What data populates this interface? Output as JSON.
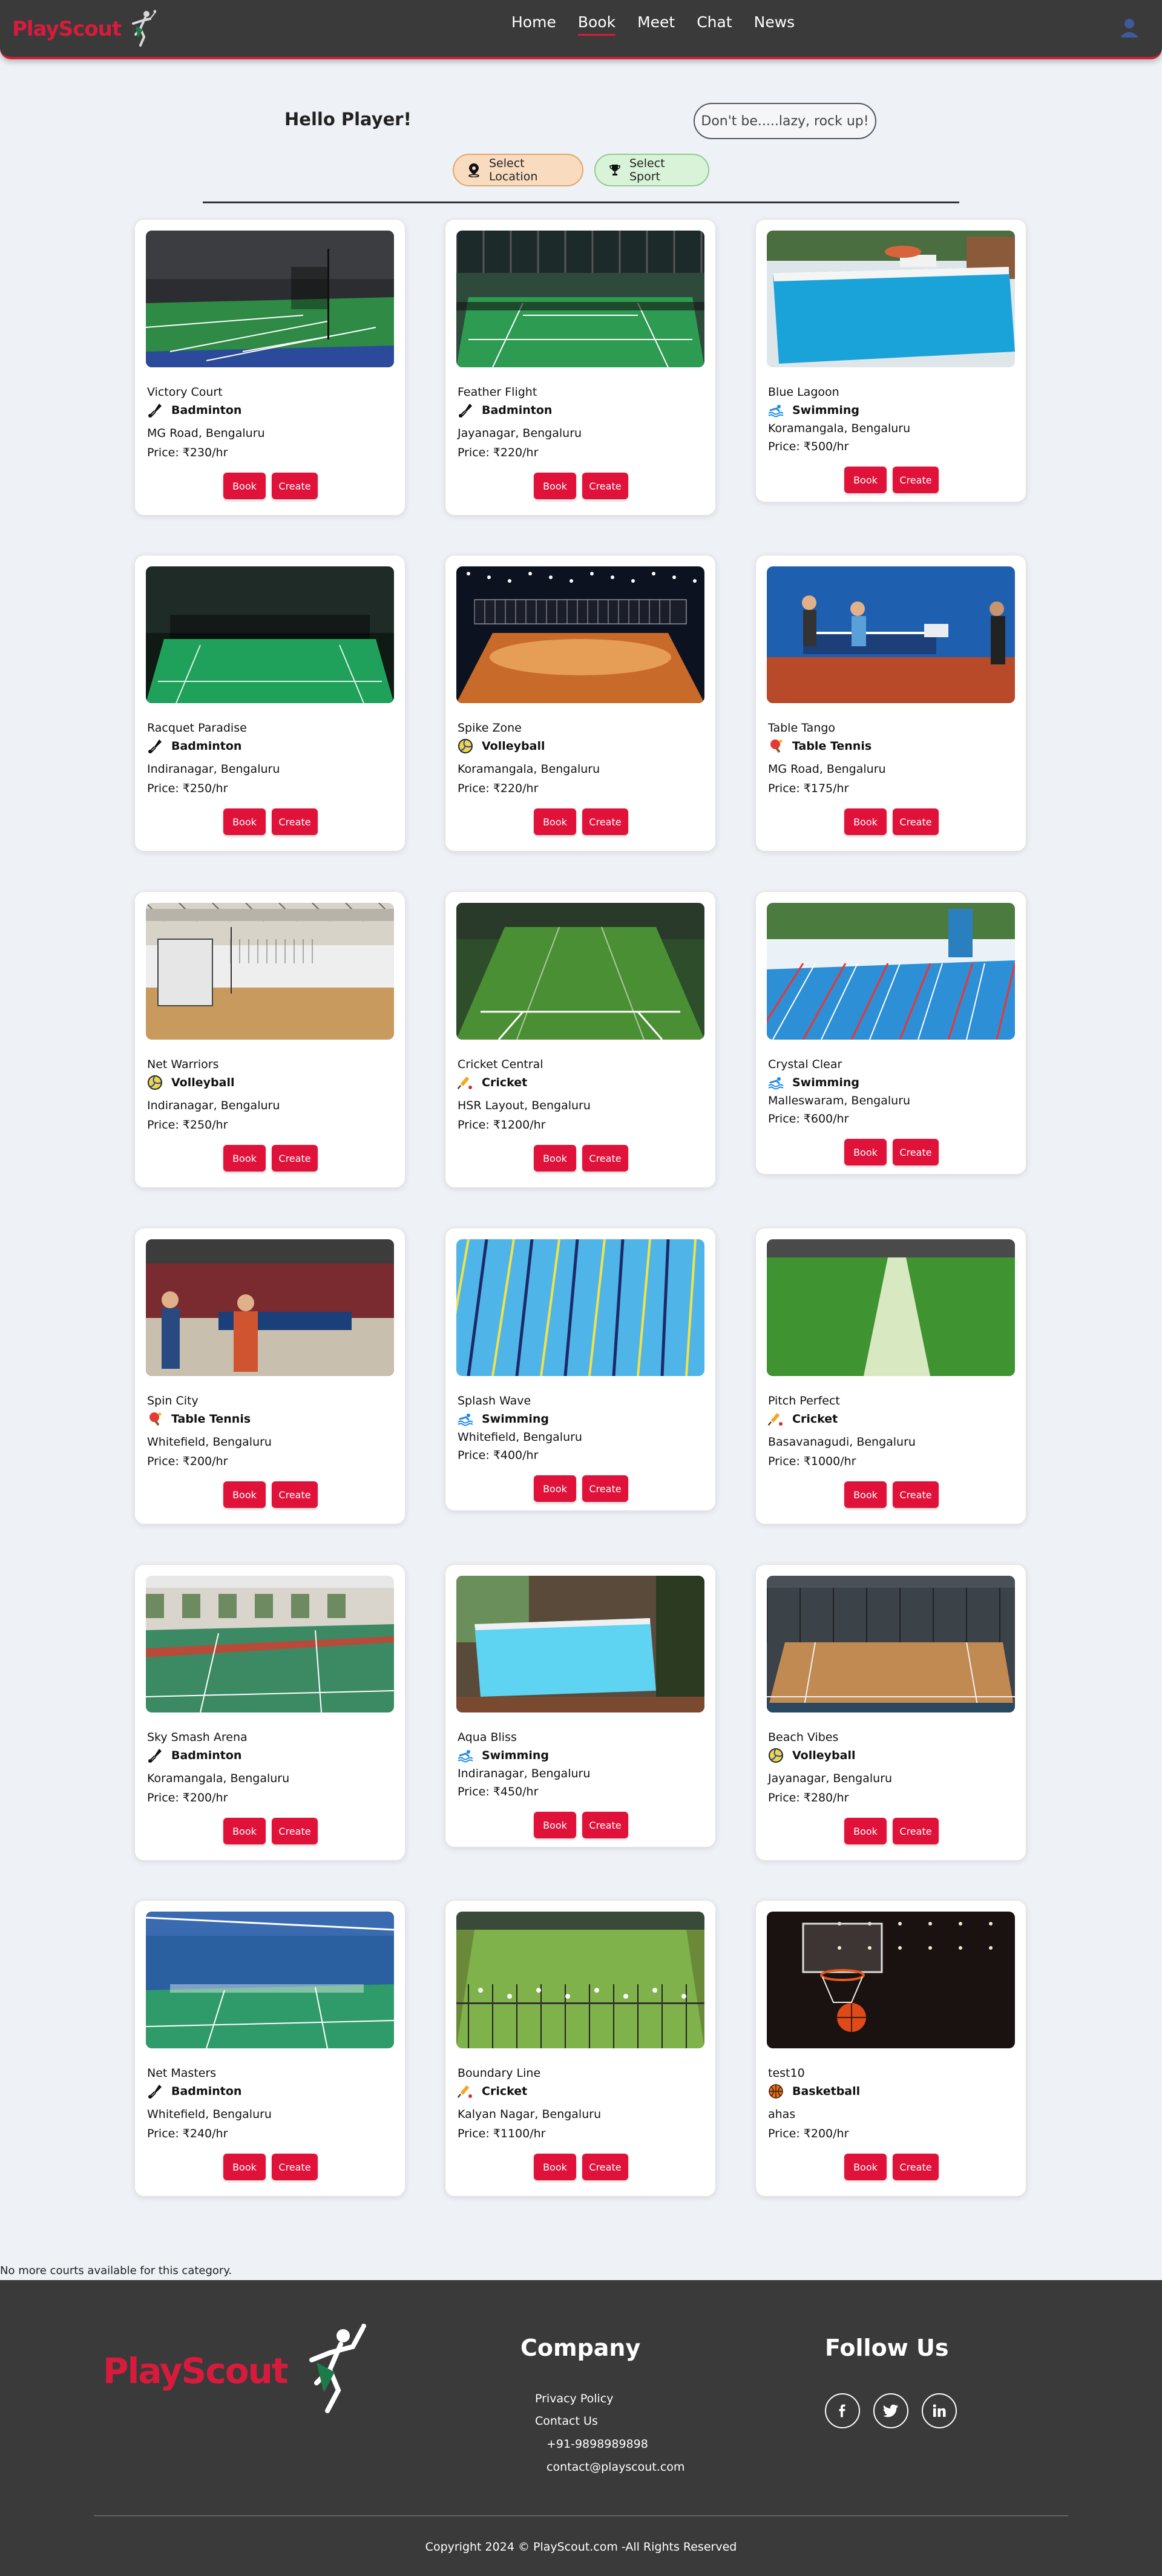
{
  "nav": {
    "brand_text": "PlayScout",
    "links": [
      {
        "label": "Home",
        "active": false
      },
      {
        "label": "Book",
        "active": true
      },
      {
        "label": "Meet",
        "active": false
      },
      {
        "label": "Chat",
        "active": false
      },
      {
        "label": "News",
        "active": false
      }
    ]
  },
  "greeting": "Hello Player!",
  "tagline": "Don't be.....lazy, rock up!",
  "filters": {
    "location_label": "Select Location",
    "sport_label": "Select Sport"
  },
  "buttons": {
    "book_label": "Book",
    "create_label": "Create"
  },
  "courts": [
    {
      "name": "Victory Court",
      "sport": "Badminton",
      "location": "MG Road, Bengaluru",
      "price": "Price: ₹230/hr",
      "icon": "shuttlecock-icon",
      "scene": "badminton-dark"
    },
    {
      "name": "Feather Flight",
      "sport": "Badminton",
      "location": "Jayanagar, Bengaluru",
      "price": "Price: ₹220/hr",
      "icon": "shuttlecock-icon",
      "scene": "badminton-hall"
    },
    {
      "name": "Blue Lagoon",
      "sport": "Swimming",
      "location": "Koramangala, Bengaluru",
      "price": "Price: ₹500/hr",
      "icon": "swimmer-icon",
      "scene": "pool-outdoor"
    },
    {
      "name": "Racquet Paradise",
      "sport": "Badminton",
      "location": "Indiranagar, Bengaluru",
      "price": "Price: ₹250/hr",
      "icon": "shuttlecock-icon",
      "scene": "badminton-green"
    },
    {
      "name": "Spike Zone",
      "sport": "Volleyball",
      "location": "Koramangala, Bengaluru",
      "price": "Price: ₹220/hr",
      "icon": "volleyball-icon",
      "scene": "volleyball-arena"
    },
    {
      "name": "Table Tango",
      "sport": "Table Tennis",
      "location": "MG Road, Bengaluru",
      "price": "Price: ₹175/hr",
      "icon": "paddle-icon",
      "scene": "tabletennis-blue"
    },
    {
      "name": "Net Warriors",
      "sport": "Volleyball",
      "location": "Indiranagar, Bengaluru",
      "price": "Price: ₹250/hr",
      "icon": "volleyball-icon",
      "scene": "indoor-wood"
    },
    {
      "name": "Cricket Central",
      "sport": "Cricket",
      "location": "HSR Layout, Bengaluru",
      "price": "Price: ₹1200/hr",
      "icon": "cricket-bat-icon",
      "scene": "cricket-turf"
    },
    {
      "name": "Crystal Clear",
      "sport": "Swimming",
      "location": "Malleswaram, Bengaluru",
      "price": "Price: ₹600/hr",
      "icon": "swimmer-icon",
      "scene": "pool-lanes-outdoor"
    },
    {
      "name": "Spin City",
      "sport": "Table Tennis",
      "location": "Whitefield, Bengaluru",
      "price": "Price: ₹200/hr",
      "icon": "paddle-icon",
      "scene": "tabletennis-hall"
    },
    {
      "name": "Splash Wave",
      "sport": "Swimming",
      "location": "Whitefield, Bengaluru",
      "price": "Price: ₹400/hr",
      "icon": "swimmer-icon",
      "scene": "pool-lanes"
    },
    {
      "name": "Pitch Perfect",
      "sport": "Cricket",
      "location": "Basavanagudi, Bengaluru",
      "price": "Price: ₹1000/hr",
      "icon": "cricket-bat-icon",
      "scene": "cricket-pitch"
    },
    {
      "name": "Sky Smash Arena",
      "sport": "Badminton",
      "location": "Koramangala, Bengaluru",
      "price": "Price: ₹200/hr",
      "icon": "shuttlecock-icon",
      "scene": "badminton-red"
    },
    {
      "name": "Aqua Bliss",
      "sport": "Swimming",
      "location": "Indiranagar, Bengaluru",
      "price": "Price: ₹450/hr",
      "icon": "swimmer-icon",
      "scene": "pool-rooftop"
    },
    {
      "name": "Beach Vibes",
      "sport": "Volleyball",
      "location": "Jayanagar, Bengaluru",
      "price": "Price: ₹280/hr",
      "icon": "volleyball-icon",
      "scene": "court-wood"
    },
    {
      "name": "Net Masters",
      "sport": "Badminton",
      "location": "Whitefield, Bengaluru",
      "price": "Price: ₹240/hr",
      "icon": "shuttlecock-icon",
      "scene": "badminton-bluehall"
    },
    {
      "name": "Boundary Line",
      "sport": "Cricket",
      "location": "Kalyan Nagar, Bengaluru",
      "price": "Price: ₹1100/hr",
      "icon": "cricket-bat-icon",
      "scene": "cricket-nets"
    },
    {
      "name": "test10",
      "sport": "Basketball",
      "location": "ahas",
      "price": "Price: ₹200/hr",
      "icon": "basketball-icon",
      "scene": "basketball-hoop"
    }
  ],
  "no_more_text": "No more courts available for this category.",
  "footer": {
    "brand_text": "PlayScout",
    "company_heading": "Company",
    "privacy_label": "Privacy Policy",
    "contact_label": "Contact Us",
    "phone": "+91-9898989898",
    "email": "contact@playscout.com",
    "follow_heading": "Follow Us",
    "socials": [
      "facebook-icon",
      "twitter-icon",
      "linkedin-icon"
    ],
    "copyright": "Copyright 2024 © PlayScout.com -All Rights Reserved"
  },
  "colors": {
    "accent": "#e0123a",
    "navbar": "#3a3a3a",
    "page_bg": "#eef1f5"
  }
}
